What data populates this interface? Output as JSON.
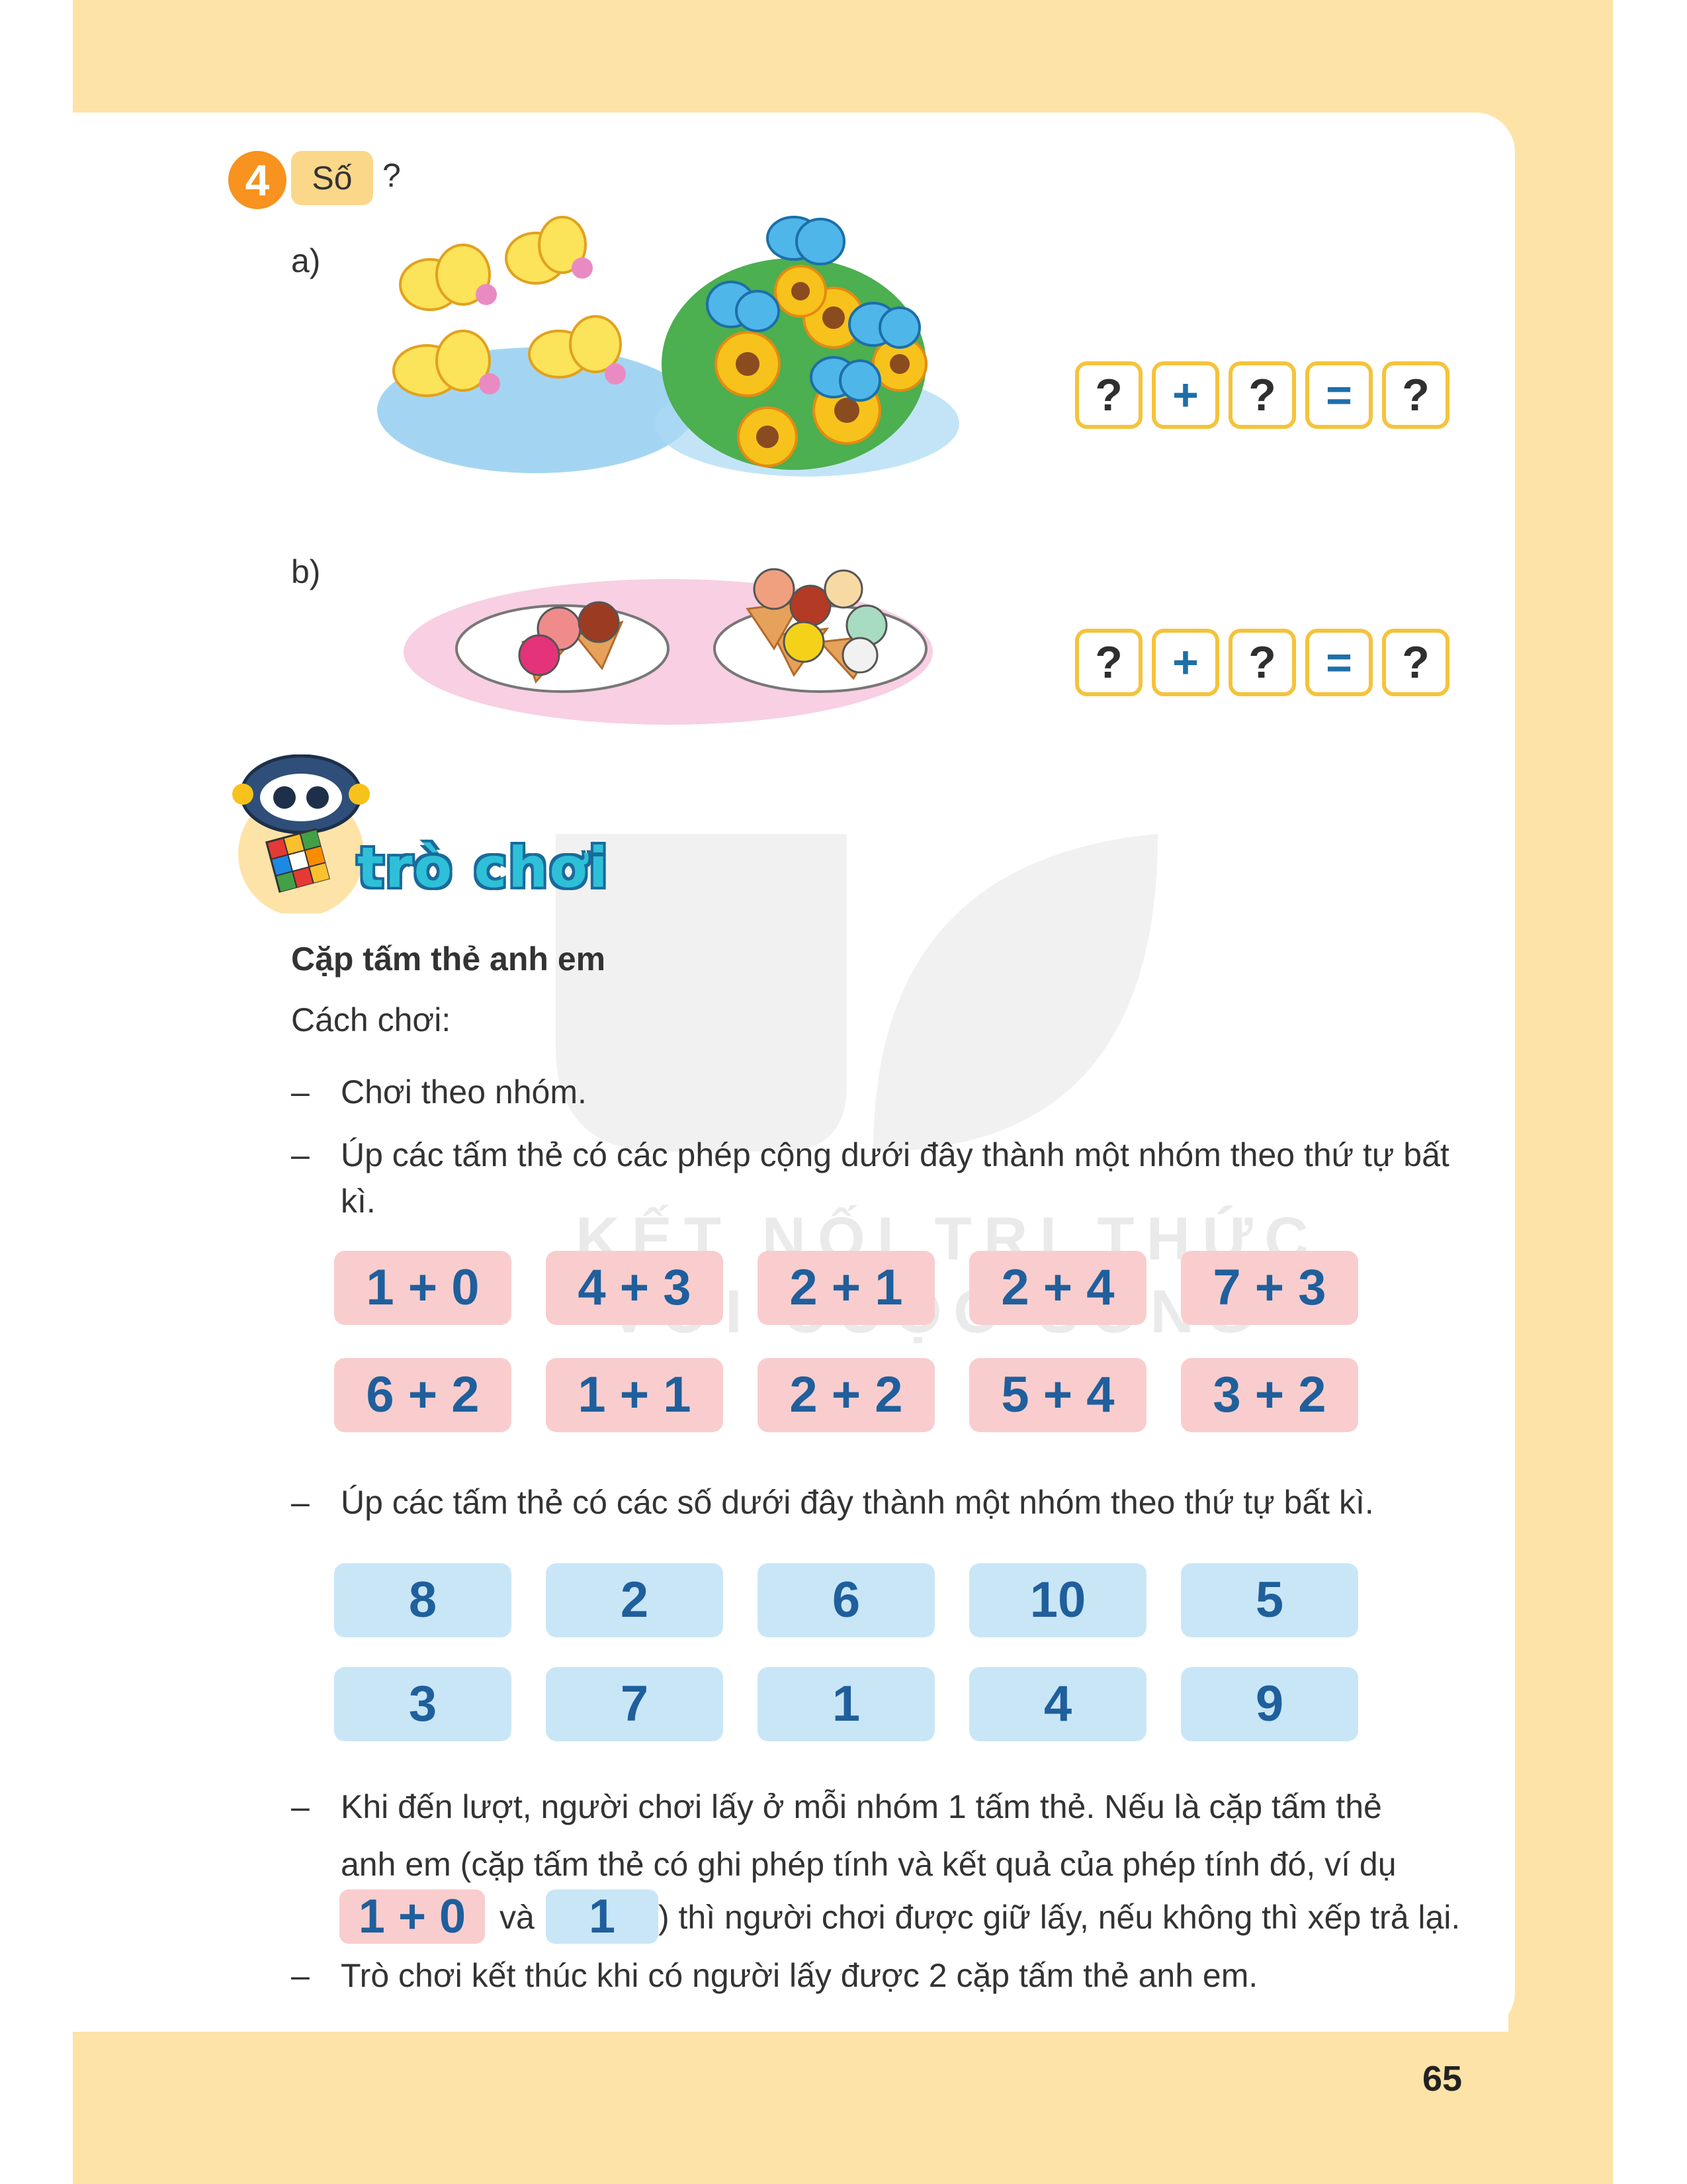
{
  "exercise": {
    "number": "4",
    "tag": "Số",
    "question_mark": "?",
    "part_a": "a)",
    "part_b": "b)",
    "equation": [
      "?",
      "+",
      "?",
      "=",
      "?"
    ]
  },
  "game": {
    "title": "trò chơi",
    "name": "Cặp tấm thẻ anh em",
    "how_to": "Cách chơi:",
    "dash": "–",
    "rule_1": "Chơi theo nhóm.",
    "rule_2": "Úp các tấm thẻ có các phép cộng dưới đây thành một nhóm theo thứ tự bất kì.",
    "addition_cards": [
      "1 + 0",
      "4 + 3",
      "2 + 1",
      "2 + 4",
      "7 + 3",
      "6 + 2",
      "1 + 1",
      "2 + 2",
      "5 + 4",
      "3 + 2"
    ],
    "rule_3": "Úp các tấm thẻ có các số dưới đây thành một nhóm theo thứ tự bất kì.",
    "number_cards": [
      "8",
      "2",
      "6",
      "10",
      "5",
      "3",
      "7",
      "1",
      "4",
      "9"
    ],
    "rule_4_line1": "Khi đến lượt, người chơi lấy ở mỗi nhóm 1 tấm thẻ. Nếu là cặp tấm thẻ",
    "rule_4_line2": "anh em (cặp tấm thẻ có ghi phép tính và kết quả của phép tính đó, ví dụ",
    "example_sum": "1 + 0",
    "example_and": "và",
    "example_result": "1",
    "rule_4_line3": ") thì người chơi được giữ lấy, nếu không thì xếp trả lại.",
    "rule_5": "Trò chơi kết thúc khi có người lấy được 2 cặp tấm thẻ anh em."
  },
  "watermark": {
    "line1": "KẾT NỐI TRI THỨC",
    "line2": "VỚI CUỘC SỐNG"
  },
  "page_number": "65",
  "colors": {
    "page_band": "#fde3a7",
    "exercise_badge": "#f7931e",
    "eq_border": "#f5c33b",
    "card_pink": "#f9cdcd",
    "card_blue": "#c9e6f7",
    "card_text": "#1f5f9c"
  }
}
